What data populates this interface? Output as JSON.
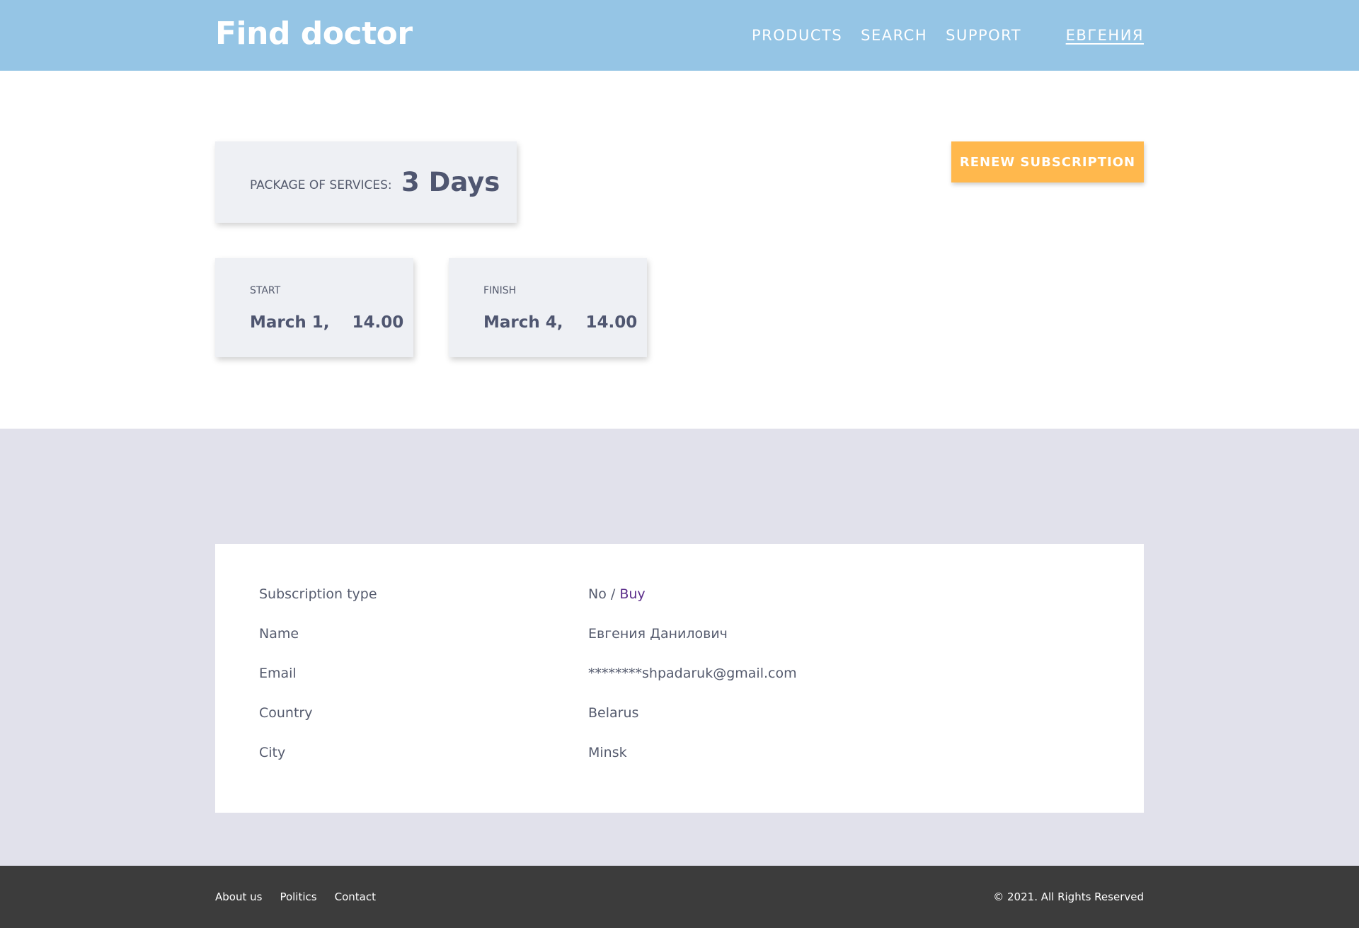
{
  "header": {
    "logo": "Find doctor",
    "nav": [
      "PRODUCTS",
      "SEARCH",
      "SUPPORT"
    ],
    "user": "ЕВГЕНИЯ"
  },
  "subscription": {
    "package_label": "PACKAGE OF SERVICES:",
    "package_value": "3 Days",
    "start_label": "START",
    "start_value": "March 1,    14.00",
    "finish_label": "FINISH",
    "finish_value": "March 4,    14.00",
    "renew_label": "RENEW SUBSCRIPTION"
  },
  "info": {
    "subscription_type_label": "Subscription type",
    "subscription_type_value": "No",
    "subscription_separator": " / ",
    "buy_label": "Buy",
    "name_label": "Name",
    "name_value": "Евгения Данилович",
    "email_label": "Email",
    "email_value": "********shpadaruk@gmail.com",
    "country_label": "Country",
    "country_value": "Belarus",
    "city_label": "City",
    "city_value": "Minsk"
  },
  "footer": {
    "links": [
      "About us",
      "Politics",
      "Contact"
    ],
    "copyright": "© 2021. All Rights Reserved"
  },
  "colors": {
    "header_bg": "#95c5e5",
    "accent_button": "#ffb84d",
    "section_bg": "#e1e1eb",
    "footer_bg": "#3c3c3c",
    "link": "#5b2d8a"
  }
}
